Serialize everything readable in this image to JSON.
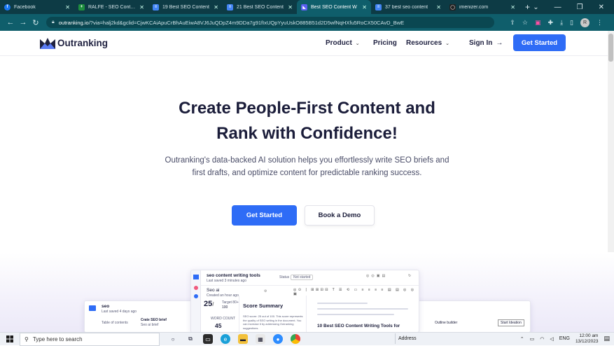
{
  "browser": {
    "tabs": [
      {
        "title": "Facebook",
        "color": "#1877f2",
        "glyph": "f"
      },
      {
        "title": "RALFE - SEO Content",
        "color": "#1e8e3e",
        "glyph": "+"
      },
      {
        "title": "19 Best SEO Content",
        "color": "#4285f4",
        "glyph": "≡"
      },
      {
        "title": "21 Best SEO Content",
        "color": "#4285f4",
        "glyph": "≡"
      },
      {
        "title": "Best SEO Content W",
        "color": "#5a5ff0",
        "glyph": "◣"
      },
      {
        "title": "37 best seo content",
        "color": "#4285f4",
        "glyph": "≡"
      },
      {
        "title": "imenizer.com",
        "color": "#222222",
        "glyph": "◯"
      }
    ],
    "url_host": "outranking.io",
    "url_rest": "/?via=halj2kd&gclid=CjwKCAiApuCrBhAuEiwA8VJ6JuQDpZ4m9DDa7g91fIxUQpYyuUskO885B51d2D5wfNqHXfu5RoCX50CAvD_BwE",
    "profile_initial": "R"
  },
  "site": {
    "logo_text": "Outranking",
    "nav": {
      "product": "Product",
      "pricing": "Pricing",
      "resources": "Resources",
      "sign_in": "Sign In",
      "get_started": "Get Started"
    },
    "hero": {
      "title_line1": "Create People-First Content and",
      "title_line2": "Rank with Confidence!",
      "sub_line1": "Outranking's data-backed AI solution helps you effortlessly write SEO briefs and",
      "sub_line2": "first drafts, and optimize content for predictable ranking success.",
      "cta_primary": "Get Started",
      "cta_secondary": "Book a Demo"
    },
    "preview": {
      "doc_title": "seo content writing tools",
      "doc_meta": "Last saved 3 minutes ago",
      "status_label": "Status",
      "status_value": "Not started",
      "sidebar_title": "Seo ai",
      "sidebar_meta": "Created an hour ago",
      "score": "25",
      "score_denom": "/",
      "target_label": "Target 80+",
      "target_value": "100",
      "word_count_label": "WORD COUNT",
      "word_count_value": "45",
      "score_summary_title": "Score Summary",
      "score_summary_text": "SEO score: 25 out of 100. This score represents the quality of SEO writing in the document. You can increase it by addressing Outranking suggestions.",
      "article_heading": "10 Best SEO Content Writing Tools for",
      "left_title": "seo",
      "left_meta": "Last saved 4 days ago",
      "left_toc": "Table of contents",
      "left_brief": "Crate SEO brief",
      "left_brief_meta": "Seo ai brief",
      "right_outline": "Outline builder",
      "right_btn": "Start Ideation"
    }
  },
  "taskbar": {
    "search_placeholder": "Type here to search",
    "address_label": "Address",
    "lang": "ENG",
    "time": "12:00 am",
    "date": "13/12/2023"
  }
}
